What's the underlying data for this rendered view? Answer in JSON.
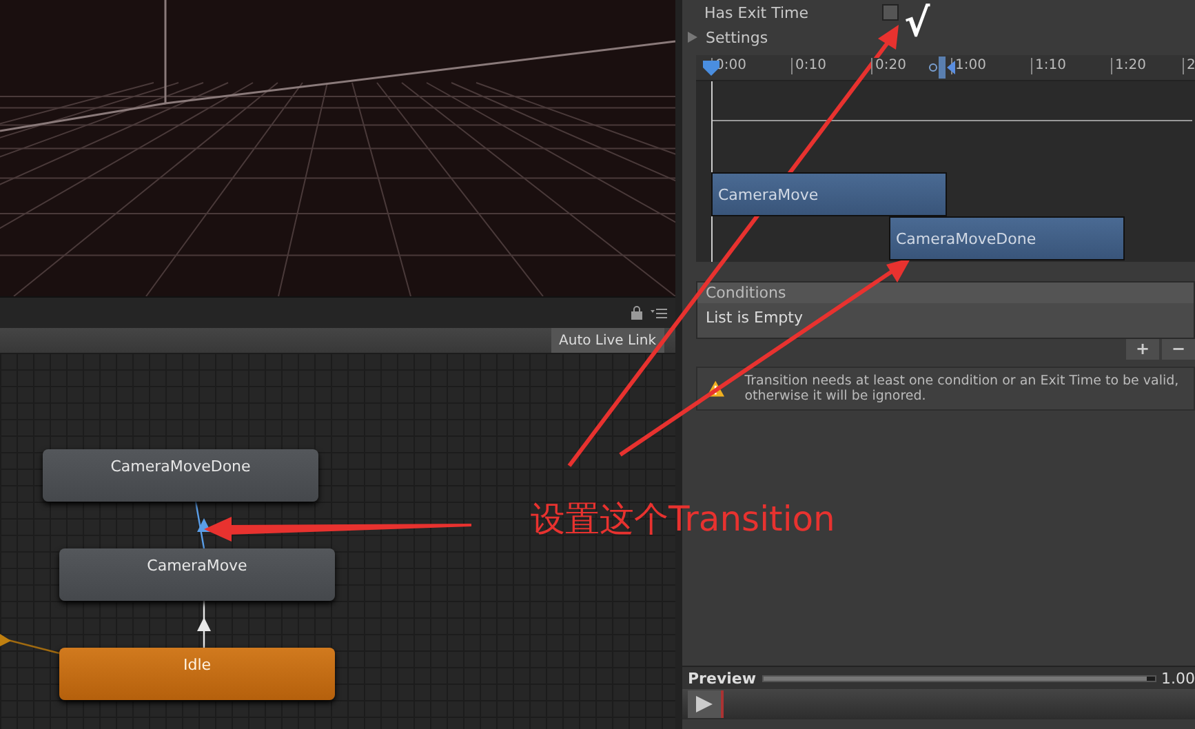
{
  "toolbar": {
    "auto_live_link": "Auto Live Link"
  },
  "graph": {
    "states": [
      {
        "name": "CameraMoveDone",
        "kind": "normal"
      },
      {
        "name": "CameraMove",
        "kind": "normal"
      },
      {
        "name": "Idle",
        "kind": "default"
      }
    ],
    "transitions": [
      {
        "selected": true
      },
      {
        "selected": false
      }
    ]
  },
  "inspector": {
    "has_exit_time": {
      "label": "Has Exit Time",
      "checked": false
    },
    "settings": {
      "label": "Settings",
      "expanded": false
    },
    "timeline": {
      "ticks": [
        "0:00",
        "0:10",
        "0:20",
        "1:00",
        "1:10",
        "1:20",
        "2"
      ],
      "clips": [
        "CameraMove",
        "CameraMoveDone"
      ]
    },
    "conditions": {
      "title": "Conditions",
      "empty_text": "List is Empty",
      "add": "+",
      "remove": "−"
    },
    "warning": "Transition needs at least one condition or an Exit Time to be valid, otherwise it will be ignored.",
    "preview": {
      "label": "Preview",
      "level": 0.98,
      "reading": "1.00"
    }
  },
  "annotation": {
    "check_mark": "√",
    "caption": "设置这个Transition"
  }
}
